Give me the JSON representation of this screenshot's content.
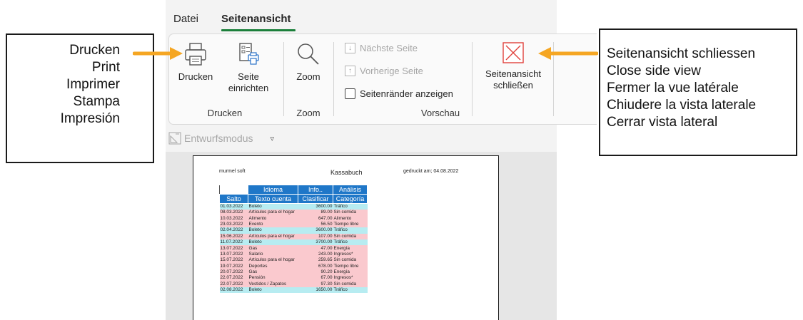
{
  "tabs": {
    "file": "Datei",
    "active": "Seitenansicht"
  },
  "ribbon": {
    "print_group": {
      "print_label": "Drucken",
      "page_setup_label_1": "Seite",
      "page_setup_label_2": "einrichten",
      "group_label": "Drucken"
    },
    "zoom_group": {
      "zoom_label": "Zoom",
      "group_label": "Zoom"
    },
    "preview_group": {
      "next_page": "Nächste Seite",
      "prev_page": "Vorherige Seite",
      "show_margins": "Seitenränder anzeigen",
      "group_label": "Vorschau",
      "close_label_1": "Seitenansicht",
      "close_label_2": "schließen"
    },
    "design_mode": "Entwurfsmodus"
  },
  "preview": {
    "company": "murmel soft",
    "title": "Kassabuch",
    "printed": "gedruckt am; 04.08.2022",
    "group_headers": [
      "Idioma",
      "Info..",
      "Análisis"
    ],
    "col_headers": [
      "Salto",
      "Texto cuenta",
      "Clasificar",
      "Categoría"
    ],
    "rows": [
      {
        "date": "01.03.2022",
        "text": "Boleto",
        "amount": "3600.00",
        "category": "Tráfico",
        "color": "blue"
      },
      {
        "date": "08.03.2022",
        "text": "Artículos para el hogar",
        "amount": "89.00",
        "category": "Sin comida",
        "color": "pink"
      },
      {
        "date": "10.03.2022",
        "text": "Alimento",
        "amount": "647.00",
        "category": "Alimento",
        "color": "pink"
      },
      {
        "date": "23.03.2022",
        "text": "Evento",
        "amount": "56.50",
        "category": "Tiempo libre",
        "color": "pink"
      },
      {
        "date": "02.04.2022",
        "text": "Boleto",
        "amount": "3600.00",
        "category": "Tráfico",
        "color": "blue"
      },
      {
        "date": "15.06.2022",
        "text": "Artículos para el hogar",
        "amount": "107.00",
        "category": "Sin comida",
        "color": "pink"
      },
      {
        "date": "11.07.2022",
        "text": "Boleto",
        "amount": "3700.00",
        "category": "Tráfico",
        "color": "blue"
      },
      {
        "date": "13.07.2022",
        "text": "Gas",
        "amount": "47.00",
        "category": "Energía",
        "color": "pink"
      },
      {
        "date": "13.07.2022",
        "text": "Salario",
        "amount": "243.00",
        "category": "Ingresos*",
        "color": "pink"
      },
      {
        "date": "15.07.2022",
        "text": "Artículos para el hogar",
        "amount": "259.65",
        "category": "Sin comida",
        "color": "pink"
      },
      {
        "date": "19.07.2022",
        "text": "Deportes",
        "amount": "678.00",
        "category": "Tiempo libre",
        "color": "pink"
      },
      {
        "date": "20.07.2022",
        "text": "Gas",
        "amount": "90.20",
        "category": "Energía",
        "color": "pink"
      },
      {
        "date": "22.07.2022",
        "text": "Pensión",
        "amount": "67.00",
        "category": "Ingresos*",
        "color": "pink"
      },
      {
        "date": "22.07.2022",
        "text": "Vestidos / Zapatos",
        "amount": "97.30",
        "category": "Sin comida",
        "color": "pink"
      },
      {
        "date": "02.08.2022",
        "text": "Boleto",
        "amount": "1650.00",
        "category": "Tráfico",
        "color": "blue"
      }
    ]
  },
  "callouts": {
    "print": [
      "Drucken",
      "Print",
      "Imprimer",
      "Stampa",
      "Impresión"
    ],
    "close": [
      "Seitenansicht schliessen",
      "Close side view",
      "Fermer la vue latérale",
      "Chiudere la vista laterale",
      "Cerrar vista lateral"
    ]
  },
  "colors": {
    "accent_tab": "#1b7f3a",
    "arrow": "#f5a623",
    "header_blue": "#1f77c8",
    "row_blue": "#b7ecf1",
    "row_pink": "#fac9ce",
    "close_icon": "#e0413c"
  }
}
